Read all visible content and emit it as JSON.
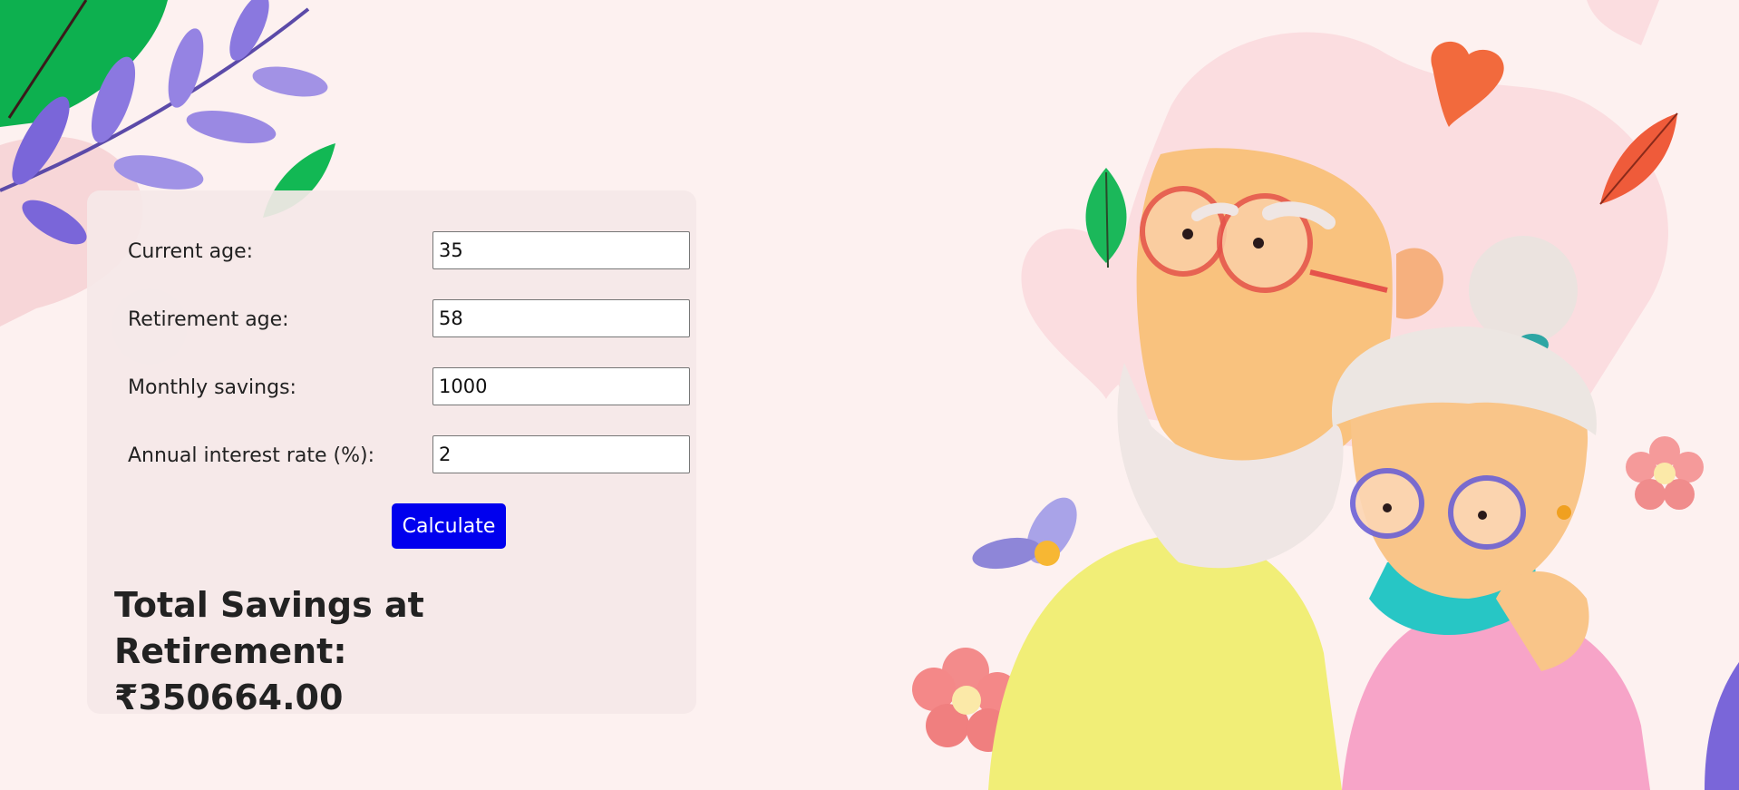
{
  "form": {
    "current_age": {
      "label": "Current age:",
      "value": "35"
    },
    "retirement_age": {
      "label": "Retirement age:",
      "value": "58"
    },
    "monthly_savings": {
      "label": "Monthly savings:",
      "value": "1000"
    },
    "annual_interest_rate": {
      "label": "Annual interest rate (%):",
      "value": "2"
    },
    "calculate_label": "Calculate"
  },
  "result": {
    "heading": "Total Savings at Retirement:",
    "amount": "₹350664.00"
  },
  "colors": {
    "background": "#fdf1f0",
    "card": "#f5e8e8",
    "button": "#0000ee"
  }
}
